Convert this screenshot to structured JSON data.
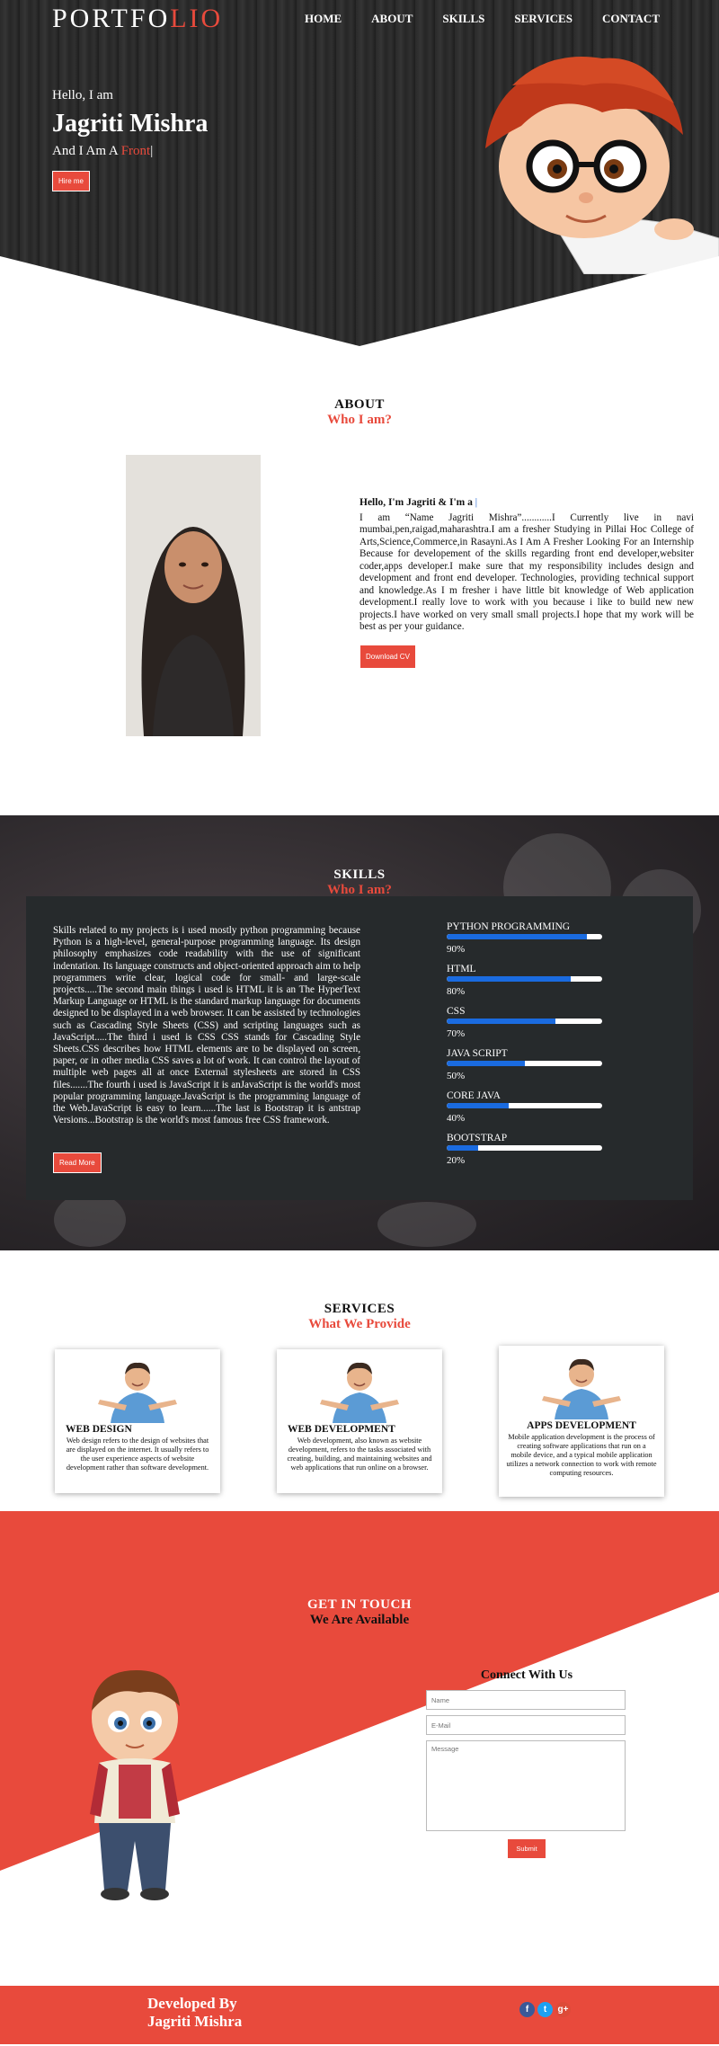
{
  "colors": {
    "accent": "#e84a3c",
    "dark": "#262a2c",
    "progress": "#1a6be0"
  },
  "logo": {
    "part1": "PORTFO",
    "part2": "LIO"
  },
  "nav": [
    "HOME",
    "ABOUT",
    "SKILLS",
    "SERVICES",
    "CONTACT"
  ],
  "hero": {
    "greeting": "Hello, I am",
    "name": "Jagriti Mishra",
    "tagline_prefix": "And I Am A ",
    "tagline_typed": "Front",
    "cursor": "|",
    "button": "Hire me"
  },
  "about": {
    "heading": "ABOUT",
    "subheading": "Who I am?",
    "hello": "Hello, I'm Jagriti & I'm a ",
    "hello_cursor": "|",
    "body": "I am “Name Jagriti Mishra”............I Currently live in navi mumbai,pen,raigad,maharashtra.I am a fresher Studying in Pillai Hoc College of Arts,Science,Commerce,in Rasayni.As I Am A Fresher Looking For an Internship Because for developement of the skills regarding front end developer,websiter coder,apps developer.I make sure that my responsibility includes design and development and front end developer. Technologies, providing technical support and knowledge.As I m fresher i have little bit knowledge of Web application development.I really love to work with you because i like to build new new projects.I have worked on very small small projects.I hope that my work will be best as per your guidance.",
    "button": "Download CV"
  },
  "skills": {
    "heading": "SKILLS",
    "subheading": "Who I am?",
    "body": "Skills related to my projects is i used mostly python programming because Python is a high-level, general-purpose programming language. Its design philosophy emphasizes code readability with the use of significant indentation. Its language constructs and object-oriented approach aim to help programmers write clear, logical code for small- and large-scale projects.....The second main things i used is HTML it is an The HyperText Markup Language or HTML is the standard markup language for documents designed to be displayed in a web browser. It can be assisted by technologies such as Cascading Style Sheets (CSS) and scripting languages such as JavaScript.....The third i used is CSS CSS stands for Cascading Style Sheets.CSS describes how HTML elements are to be displayed on screen, paper, or in other media CSS saves a lot of work. It can control the layout of multiple web pages all at once External stylesheets are stored in CSS files.......The fourth i used is JavaScript it is anJavaScript is the world's most popular programming language.JavaScript is the programming language of the Web.JavaScript is easy to learn......The last is Bootstrap it is antstrap Versions...Bootstrap is the world's most famous free CSS framework.",
    "button": "Read More",
    "items": [
      {
        "name": "PYTHON PROGRAMMING",
        "percent": 90,
        "label": "90%"
      },
      {
        "name": "HTML",
        "percent": 80,
        "label": "80%"
      },
      {
        "name": "CSS",
        "percent": 70,
        "label": "70%"
      },
      {
        "name": "JAVA SCRIPT",
        "percent": 50,
        "label": "50%"
      },
      {
        "name": "CORE JAVA",
        "percent": 40,
        "label": "40%"
      },
      {
        "name": "BOOTSTRAP",
        "percent": 20,
        "label": "20%"
      }
    ]
  },
  "services": {
    "heading": "SERVICES",
    "subheading": "What We Provide",
    "cards": [
      {
        "title": "WEB DESIGN",
        "desc": "Web design refers to the design of websites that are displayed on the internet. It usually refers to the user experience aspects of website development rather than software development."
      },
      {
        "title": "WEB DEVELOPMENT",
        "desc": "Web development, also known as website development, refers to the tasks associated with creating, building, and maintaining websites and web applications that run online on a browser."
      },
      {
        "title": "APPS DEVELOPMENT",
        "desc": "Mobile application development is the process of creating software applications that run on a mobile device, and a typical mobile application utilizes a network connection to work with remote computing resources."
      }
    ]
  },
  "contact": {
    "heading": "GET IN TOUCH",
    "subheading": "We Are Available",
    "form_title": "Connect With Us",
    "name_placeholder": "Name",
    "email_placeholder": "E-Mail",
    "message_placeholder": "Message",
    "submit": "Submit"
  },
  "footer": {
    "line1": "Developed By",
    "line2": "Jagriti Mishra",
    "socials": [
      {
        "icon": "facebook-icon",
        "glyph": "f",
        "color": "#3b5998"
      },
      {
        "icon": "twitter-icon",
        "glyph": "t",
        "color": "#1da1f2"
      },
      {
        "icon": "google-plus-icon",
        "glyph": "g+",
        "color": "#dd4b39"
      }
    ]
  }
}
